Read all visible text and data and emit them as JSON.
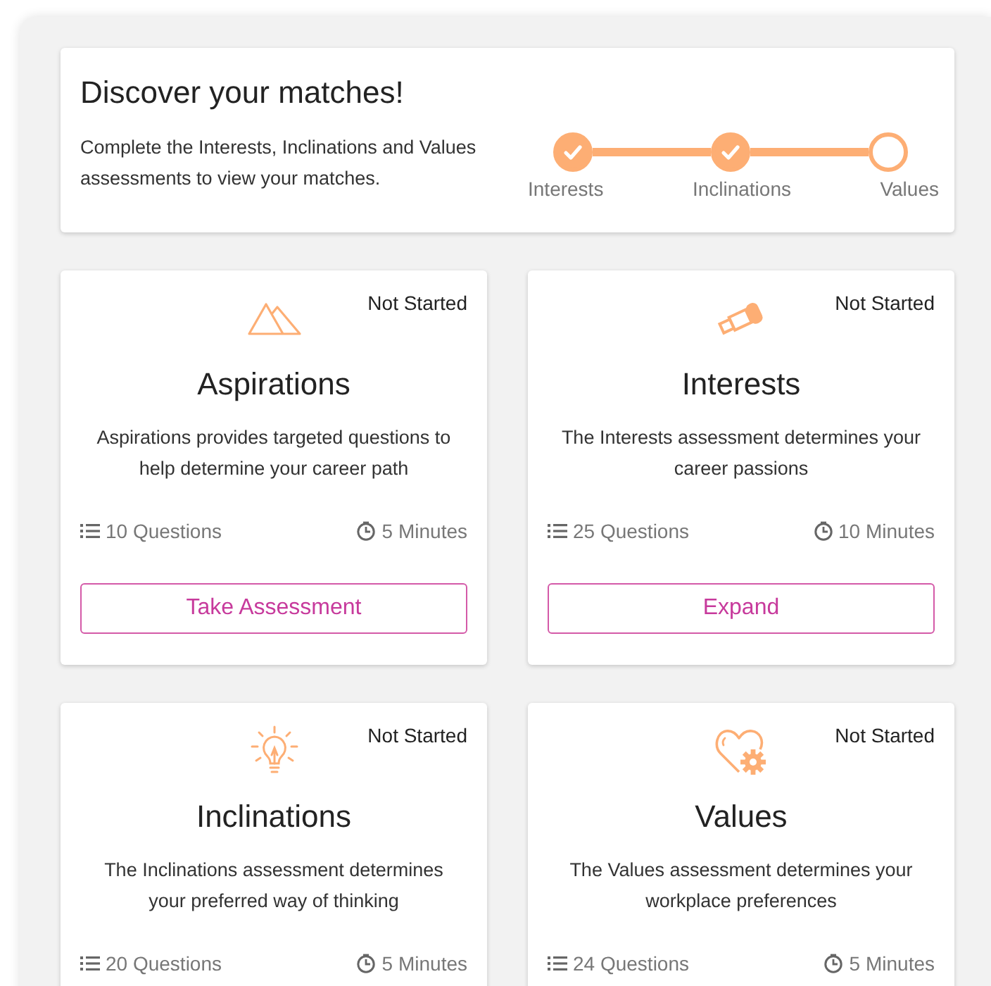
{
  "summary": {
    "title": "Discover your matches!",
    "description": "Complete the Interests, Inclinations and Values assessments to view your matches.",
    "steps": [
      {
        "label": "Interests",
        "completed": true
      },
      {
        "label": "Inclinations",
        "completed": true
      },
      {
        "label": "Values",
        "completed": false
      }
    ]
  },
  "assessments": [
    {
      "kind": "mountains",
      "status": "Not Started",
      "title": "Aspirations",
      "description": "Aspirations provides targeted questions to help determine your career path",
      "questions": "10 Questions",
      "duration": "5 Minutes",
      "button": "Take Assessment"
    },
    {
      "kind": "telescope",
      "status": "Not Started",
      "title": "Interests",
      "description": "The Interests assessment determines your career passions",
      "questions": "25 Questions",
      "duration": "10 Minutes",
      "button": "Expand"
    },
    {
      "kind": "lightbulb",
      "status": "Not Started",
      "title": "Inclinations",
      "description": "The Inclinations assessment determines your preferred way of thinking",
      "questions": "20 Questions",
      "duration": "5 Minutes"
    },
    {
      "kind": "heart-gear",
      "status": "Not Started",
      "title": "Values",
      "description": "The Values assessment determines your workplace preferences",
      "questions": "24 Questions",
      "duration": "5 Minutes"
    }
  ]
}
